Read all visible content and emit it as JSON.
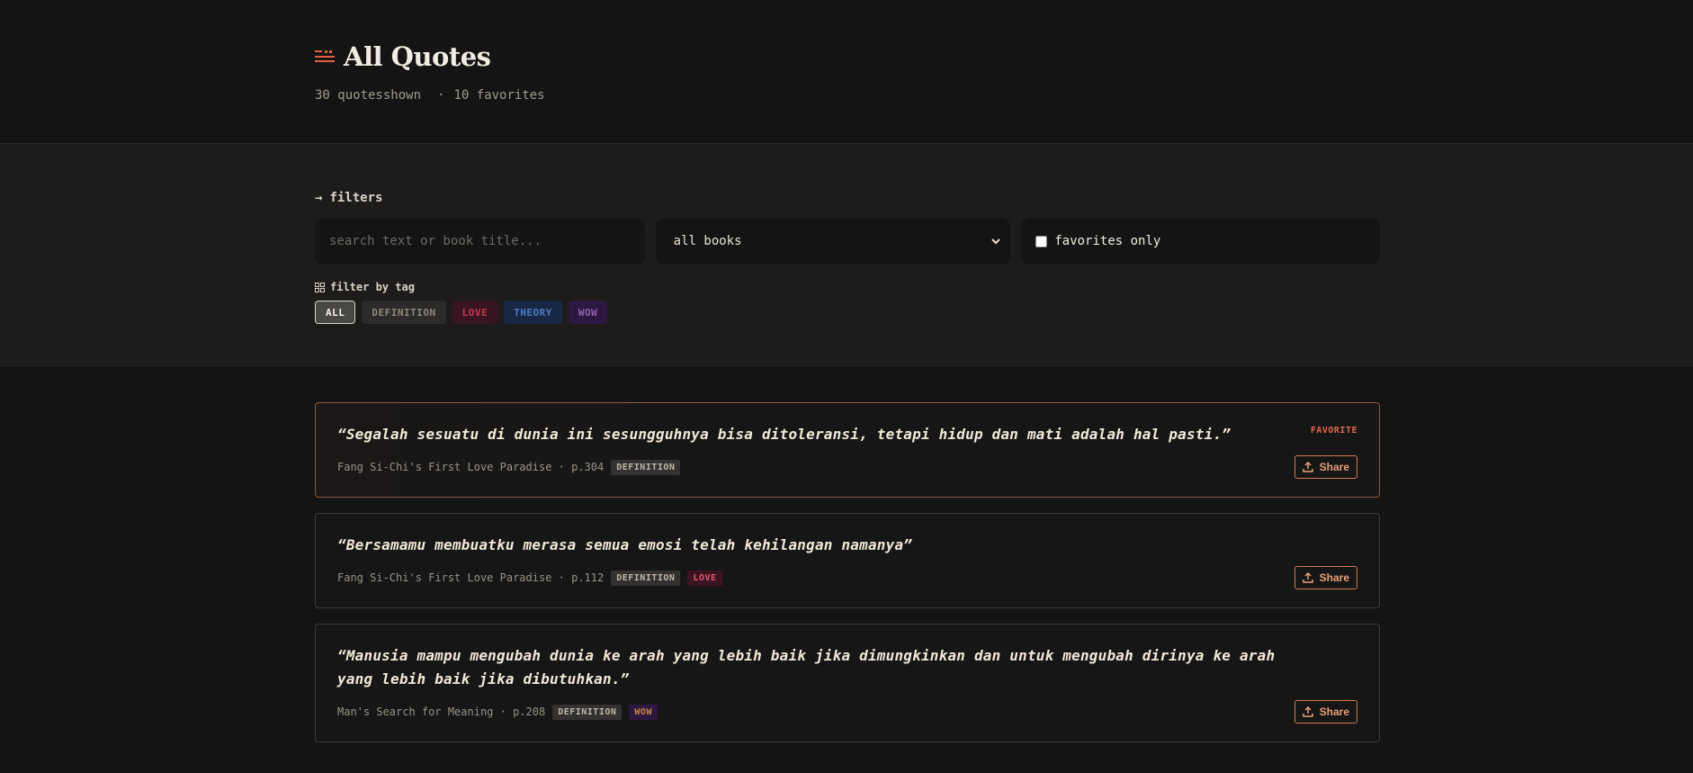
{
  "header": {
    "title": "All Quotes",
    "count_text": "30 quotesshown",
    "favorites_text": "10 favorites"
  },
  "filters": {
    "section_label": "filters",
    "search_placeholder": "search text or book title...",
    "book_select_value": "all books",
    "favorites_only_label": "favorites only",
    "tag_label": "filter by tag",
    "tags": [
      "ALL",
      "DEFINITION",
      "LOVE",
      "THEORY",
      "WOW"
    ]
  },
  "quotes": [
    {
      "text": "“Segalah sesuatu di dunia ini sesungguhnya bisa ditoleransi, tetapi hidup dan mati adalah hal pasti.”",
      "source": "Fang Si-Chi's First Love Paradise · p.304",
      "badge": "FAVORITE",
      "tags": [
        "DEFINITION"
      ],
      "share_label": "Share"
    },
    {
      "text": "“Bersamamu membuatku merasa semua emosi telah kehilangan namanya”",
      "source": "Fang Si-Chi's First Love Paradise · p.112",
      "tags": [
        "DEFINITION",
        "LOVE"
      ],
      "share_label": "Share"
    },
    {
      "text": "“Manusia mampu mengubah dunia ke arah yang lebih baik jika dimungkinkan dan untuk mengubah dirinya ke arah yang lebih baik jika dibutuhkan.”",
      "source": "Man's Search for Meaning · p.208",
      "tags": [
        "DEFINITION",
        "WOW"
      ],
      "share_label": "Share"
    }
  ],
  "colors": {
    "background": "#141414",
    "accent": "#d17a52",
    "favorite": "#e06a4a"
  }
}
